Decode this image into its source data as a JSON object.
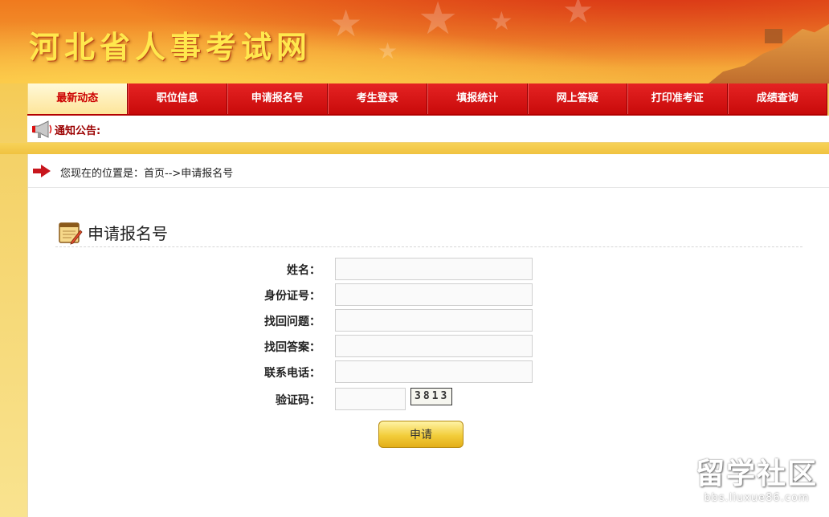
{
  "header": {
    "site_title": "河北省人事考试网"
  },
  "nav": {
    "items": [
      {
        "label": "最新动态",
        "active": true
      },
      {
        "label": "职位信息",
        "active": false
      },
      {
        "label": "申请报名号",
        "active": false
      },
      {
        "label": "考生登录",
        "active": false
      },
      {
        "label": "填报统计",
        "active": false
      },
      {
        "label": "网上答疑",
        "active": false
      },
      {
        "label": "打印准考证",
        "active": false
      },
      {
        "label": "成绩查询",
        "active": false
      }
    ]
  },
  "notice": {
    "label": "通知公告:",
    "icon": "megaphone-icon"
  },
  "breadcrumb": {
    "text": "您现在的位置是：首页-->申请报名号",
    "icon": "arrow-right-icon"
  },
  "form": {
    "title": "申请报名号",
    "title_icon": "notepad-icon",
    "fields": [
      {
        "label": "姓名：",
        "value": ""
      },
      {
        "label": "身份证号：",
        "value": ""
      },
      {
        "label": "找回问题：",
        "value": ""
      },
      {
        "label": "找回答案：",
        "value": ""
      },
      {
        "label": "联系电话：",
        "value": ""
      },
      {
        "label": "验证码：",
        "value": ""
      }
    ],
    "captcha_text": "3813",
    "submit_label": "申请"
  },
  "watermark": {
    "big": "留学社区",
    "small": "bbs.liuxue86.com"
  },
  "colors": {
    "nav_red": "#d70d0d",
    "nav_active_bg": "#fde59a",
    "banner_orange": "#f07a1e",
    "title_yellow": "#ffe84d",
    "button_gold": "#f2cd3b"
  }
}
